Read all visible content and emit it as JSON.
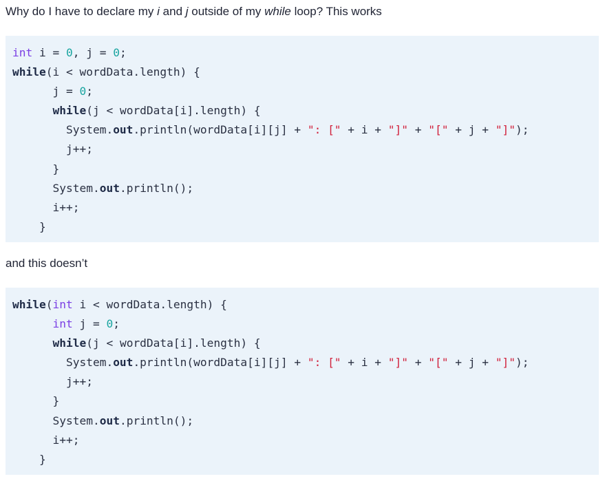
{
  "question": {
    "parts": [
      {
        "text": "Why do I have to declare my ",
        "italic": false
      },
      {
        "text": "i",
        "italic": true
      },
      {
        "text": " and ",
        "italic": false
      },
      {
        "text": "j",
        "italic": true
      },
      {
        "text": " outside of my ",
        "italic": false
      },
      {
        "text": "while",
        "italic": true
      },
      {
        "text": " loop? This works",
        "italic": false
      }
    ]
  },
  "between_text": "and this doesn’t",
  "code_blocks": [
    {
      "name": "working-code",
      "lines": [
        [
          [
            "kw",
            "int"
          ],
          [
            "t",
            " i = "
          ],
          [
            "num",
            "0"
          ],
          [
            "t",
            ", j = "
          ],
          [
            "num",
            "0"
          ],
          [
            "t",
            ";"
          ]
        ],
        [
          [
            "kwb",
            "while"
          ],
          [
            "t",
            "(i < wordData.length) {"
          ]
        ],
        [
          [
            "t",
            "      j = "
          ],
          [
            "num",
            "0"
          ],
          [
            "t",
            ";"
          ]
        ],
        [
          [
            "t",
            "      "
          ],
          [
            "kwb",
            "while"
          ],
          [
            "t",
            "(j < wordData[i].length) {"
          ]
        ],
        [
          [
            "t",
            "        System."
          ],
          [
            "fld",
            "out"
          ],
          [
            "t",
            ".println(wordData[i][j] + "
          ],
          [
            "str",
            "\": [\""
          ],
          [
            "t",
            " + i + "
          ],
          [
            "str",
            "\"]\""
          ],
          [
            "t",
            " + "
          ],
          [
            "str",
            "\"[\""
          ],
          [
            "t",
            " + j + "
          ],
          [
            "str",
            "\"]\""
          ],
          [
            "t",
            ");"
          ]
        ],
        [
          [
            "t",
            "        j++;"
          ]
        ],
        [
          [
            "t",
            "      }"
          ]
        ],
        [
          [
            "t",
            "      System."
          ],
          [
            "fld",
            "out"
          ],
          [
            "t",
            ".println();"
          ]
        ],
        [
          [
            "t",
            "      i++;"
          ]
        ],
        [
          [
            "t",
            "    }"
          ]
        ]
      ]
    },
    {
      "name": "broken-code",
      "lines": [
        [
          [
            "kwb",
            "while"
          ],
          [
            "t",
            "("
          ],
          [
            "kw",
            "int"
          ],
          [
            "t",
            " i < wordData.length) {"
          ]
        ],
        [
          [
            "t",
            "      "
          ],
          [
            "kw",
            "int"
          ],
          [
            "t",
            " j = "
          ],
          [
            "num",
            "0"
          ],
          [
            "t",
            ";"
          ]
        ],
        [
          [
            "t",
            "      "
          ],
          [
            "kwb",
            "while"
          ],
          [
            "t",
            "(j < wordData[i].length) {"
          ]
        ],
        [
          [
            "t",
            "        System."
          ],
          [
            "fld",
            "out"
          ],
          [
            "t",
            ".println(wordData[i][j] + "
          ],
          [
            "str",
            "\": [\""
          ],
          [
            "t",
            " + i + "
          ],
          [
            "str",
            "\"]\""
          ],
          [
            "t",
            " + "
          ],
          [
            "str",
            "\"[\""
          ],
          [
            "t",
            " + j + "
          ],
          [
            "str",
            "\"]\""
          ],
          [
            "t",
            ");"
          ]
        ],
        [
          [
            "t",
            "        j++;"
          ]
        ],
        [
          [
            "t",
            "      }"
          ]
        ],
        [
          [
            "t",
            "      System."
          ],
          [
            "fld",
            "out"
          ],
          [
            "t",
            ".println();"
          ]
        ],
        [
          [
            "t",
            "      i++;"
          ]
        ],
        [
          [
            "t",
            "    }"
          ]
        ]
      ]
    }
  ]
}
